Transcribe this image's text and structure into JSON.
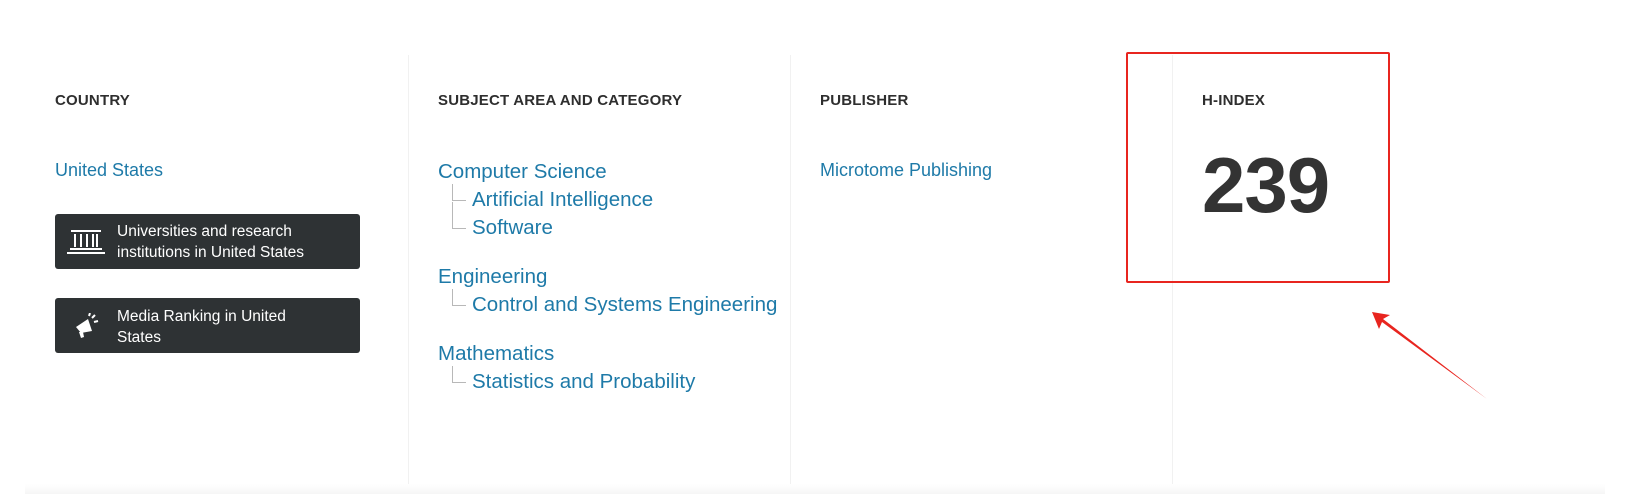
{
  "country": {
    "heading": "COUNTRY",
    "link": "United States",
    "buttons": [
      {
        "icon": "institution-columns-icon",
        "label": "Universities and research institutions in United States"
      },
      {
        "icon": "megaphone-icon",
        "label": "Media Ranking in United States"
      }
    ]
  },
  "subject": {
    "heading": "SUBJECT AREA AND CATEGORY",
    "areas": [
      {
        "name": "Computer Science",
        "categories": [
          "Artificial Intelligence",
          "Software"
        ]
      },
      {
        "name": "Engineering",
        "categories": [
          "Control and Systems Engineering"
        ]
      },
      {
        "name": "Mathematics",
        "categories": [
          "Statistics and Probability"
        ]
      }
    ]
  },
  "publisher": {
    "heading": "PUBLISHER",
    "link": "Microtome Publishing"
  },
  "hindex": {
    "heading": "H-INDEX",
    "value": "239"
  },
  "colors": {
    "link": "#1e7aa8",
    "button_bg": "#2e3234",
    "annotation": "#e8251f"
  }
}
